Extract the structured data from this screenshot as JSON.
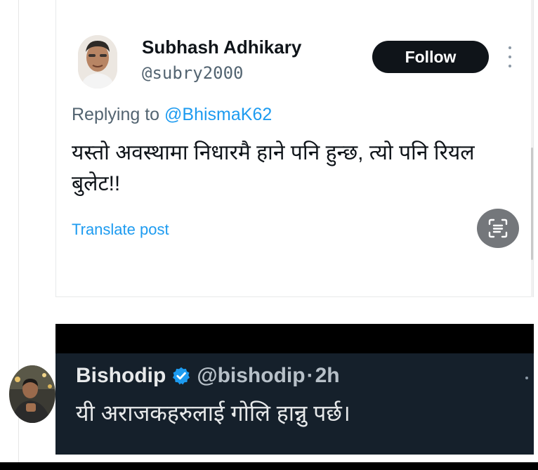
{
  "tweet": {
    "author_name": "Subhash Adhikary",
    "author_handle": "@subry2000",
    "follow_label": "Follow",
    "replying_prefix": "Replying to",
    "replying_mention": "@BhismaK62",
    "text": "यस्तो अवस्थामा निधारमै हाने पनि हुन्छ, त्यो पनि रियल बुलेट!!",
    "translate_label": "Translate post",
    "icons": {
      "more": "more-vertical-icon",
      "lens": "text-scan-icon"
    }
  },
  "embedded_tweet": {
    "author_name": "Bishodip",
    "author_handle": "@bishodip",
    "separator": "·",
    "time": "2h",
    "text": "यी अराजकहरुलाई गोलि हान्नु पर्छ।",
    "icons": {
      "verified": "verified-badge-icon",
      "more": "more-horizontal-icon"
    }
  },
  "colors": {
    "accent": "#1d9bf0",
    "follow_bg": "#0f1419",
    "dark_bg": "#15202b",
    "verified": "#1d9bf0"
  }
}
